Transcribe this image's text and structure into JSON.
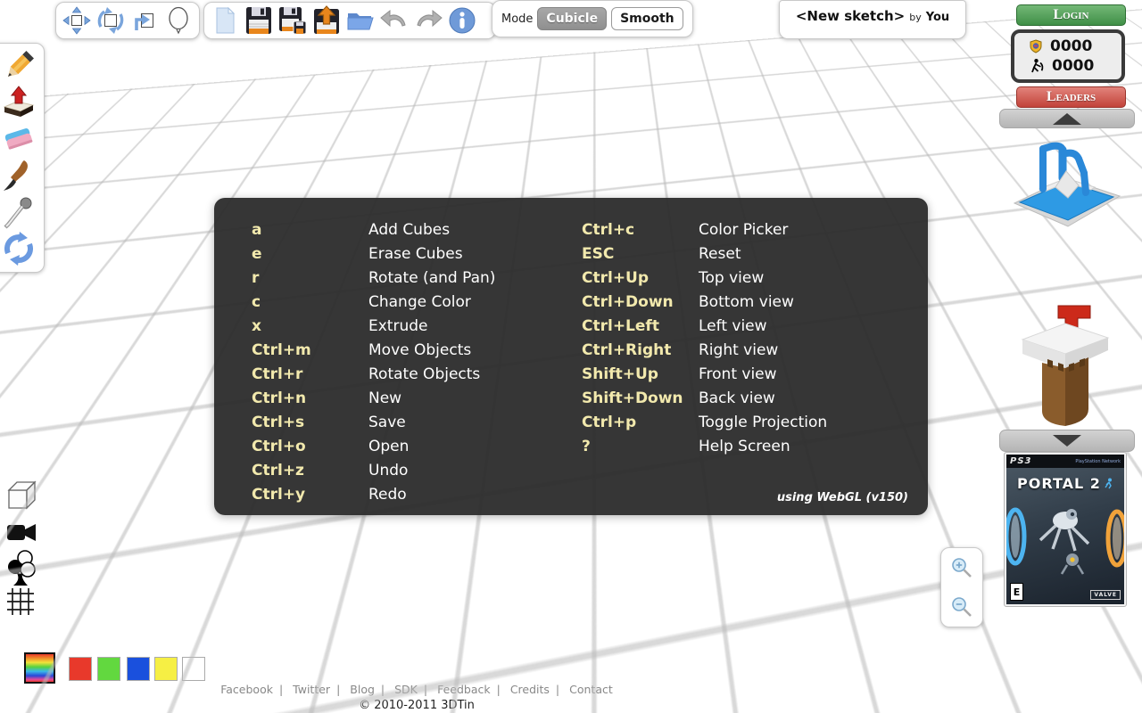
{
  "toolbar": {
    "mode_label": "Mode",
    "mode_cubicle": "Cubicle",
    "mode_smooth": "Smooth"
  },
  "sketch": {
    "title": "<New sketch>",
    "by_label": "by",
    "author": "You"
  },
  "account": {
    "login_label": "Login",
    "shield_score": "0000",
    "miner_score": "0000",
    "leaders_label": "Leaders"
  },
  "help": {
    "left": [
      {
        "key": "a",
        "desc": "Add Cubes"
      },
      {
        "key": "e",
        "desc": "Erase Cubes"
      },
      {
        "key": "r",
        "desc": "Rotate (and Pan)"
      },
      {
        "key": "c",
        "desc": "Change Color"
      },
      {
        "key": "x",
        "desc": "Extrude"
      },
      {
        "key": "Ctrl+m",
        "desc": "Move Objects"
      },
      {
        "key": "Ctrl+r",
        "desc": "Rotate Objects"
      },
      {
        "key": "Ctrl+n",
        "desc": "New"
      },
      {
        "key": "Ctrl+s",
        "desc": "Save"
      },
      {
        "key": "Ctrl+o",
        "desc": "Open"
      },
      {
        "key": "Ctrl+z",
        "desc": "Undo"
      },
      {
        "key": "Ctrl+y",
        "desc": "Redo"
      }
    ],
    "right": [
      {
        "key": "Ctrl+c",
        "desc": "Color Picker"
      },
      {
        "key": "ESC",
        "desc": "Reset"
      },
      {
        "key": "Ctrl+Up",
        "desc": "Top view"
      },
      {
        "key": "Ctrl+Down",
        "desc": "Bottom view"
      },
      {
        "key": "Ctrl+Left",
        "desc": "Left view"
      },
      {
        "key": "Ctrl+Right",
        "desc": "Right view"
      },
      {
        "key": "Shift+Up",
        "desc": "Front view"
      },
      {
        "key": "Shift+Down",
        "desc": "Back view"
      },
      {
        "key": "Ctrl+p",
        "desc": "Toggle Projection"
      },
      {
        "key": "?",
        "desc": "Help Screen"
      }
    ],
    "note": "using WebGL (v150)"
  },
  "ad": {
    "platform": "PS3",
    "network": "PlayStation Network",
    "title": "PORTAL 2",
    "rating": "E",
    "publisher": "VALVE"
  },
  "footer": {
    "links": [
      "Facebook",
      "Twitter",
      "Blog",
      "SDK",
      "Feedback",
      "Credits",
      "Contact"
    ],
    "copyright": "© 2010-2011 3DTin"
  },
  "palette": {
    "colors": [
      "#e8392b",
      "#62d83f",
      "#1a50dd",
      "#f6ef44",
      "#ffffff"
    ]
  },
  "icons": {
    "transform": [
      "move-icon",
      "rotate-icon",
      "flip-icon",
      "lasso-balloon-icon"
    ],
    "file": [
      "new-file-icon",
      "save-icon",
      "save-as-icon",
      "export-icon",
      "open-folder-icon",
      "undo-icon",
      "redo-icon",
      "info-icon"
    ],
    "draw_tools": [
      "pencil-icon",
      "extrude-icon",
      "eraser-icon",
      "brush-icon",
      "color-picker-icon",
      "refresh-icon"
    ],
    "view_tools": [
      "cube-icon",
      "camera-icon",
      "club-icon",
      "grid-icon"
    ],
    "zoom": [
      "zoom-in-icon",
      "zoom-out-icon"
    ],
    "score": [
      "shield-icon",
      "miner-icon"
    ]
  },
  "colors": {
    "accent_blue": "#7aa5dc",
    "login_green": "#4f9b55",
    "leaders_red": "#c9463d",
    "key_highlight": "#f2e9ad",
    "overlay_bg": "#2b2b2b"
  }
}
